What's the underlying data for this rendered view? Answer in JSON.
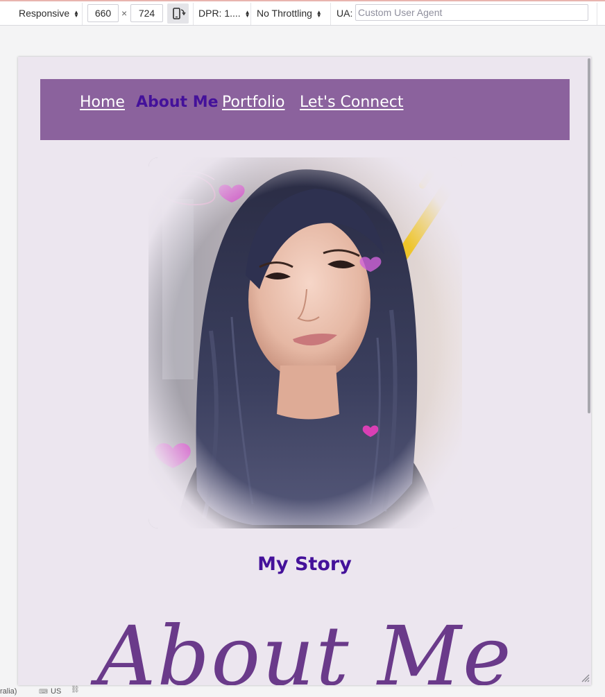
{
  "toolbar": {
    "device_mode": "Responsive",
    "width": "660",
    "times": "×",
    "height": "724",
    "dpr": "DPR: 1....",
    "throttling": "No Throttling",
    "ua_label": "UA:",
    "ua_placeholder": "Custom User Agent"
  },
  "page": {
    "nav": [
      {
        "label": "Home",
        "active": false
      },
      {
        "label": "About Me",
        "active": true
      },
      {
        "label": "Portfolio",
        "active": false
      },
      {
        "label": "Let's Connect",
        "active": false
      }
    ],
    "heading": "My Story",
    "script_title": "About Me"
  },
  "status": {
    "locale_fragment": "ralia)",
    "keyboard_label": "US"
  },
  "colors": {
    "nav_bg": "#8b629d",
    "active_link": "#44119a",
    "page_bg": "#ece6ef",
    "script_title": "#6a3a8a"
  }
}
